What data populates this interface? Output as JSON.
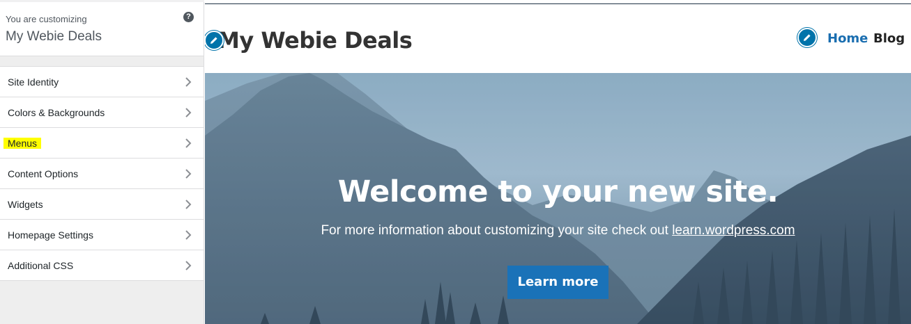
{
  "customizer": {
    "header_label": "You are customizing",
    "site_name": "My Webie Deals",
    "help_icon": "?",
    "panels": [
      {
        "label": "Site Identity"
      },
      {
        "label": "Colors & Backgrounds"
      },
      {
        "label": "Menus",
        "highlighted": true
      },
      {
        "label": "Content Options"
      },
      {
        "label": "Widgets"
      },
      {
        "label": "Homepage Settings"
      },
      {
        "label": "Additional CSS"
      }
    ]
  },
  "preview": {
    "site_title": "My Webie Deals",
    "nav": [
      {
        "label": "Home"
      },
      {
        "label": "Blog"
      }
    ],
    "hero": {
      "title": "Welcome to your new site.",
      "text": "For more information about customizing your site check out ",
      "link": "learn.wordpress.com",
      "button": "Learn more"
    }
  },
  "colors": {
    "accent": "#0073aa",
    "button": "#1a72b8",
    "highlight": "#ffff00"
  },
  "icons": {
    "help": "question-circle-icon",
    "chevron": "chevron-right-icon",
    "edit": "pencil-edit-icon"
  }
}
